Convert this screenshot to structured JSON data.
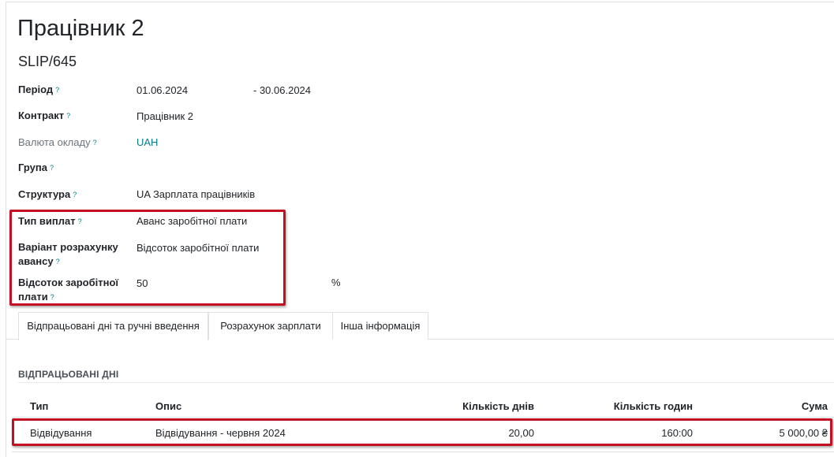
{
  "header": {
    "title": "Працівник 2",
    "reference": "SLIP/645"
  },
  "help_mark": "?",
  "fields": {
    "period": {
      "label": "Період",
      "from": "01.06.2024",
      "to": "- 30.06.2024"
    },
    "contract": {
      "label": "Контракт",
      "value": "Працівник 2"
    },
    "salary_currency": {
      "label": "Валюта окладу",
      "value": "UAH"
    },
    "group": {
      "label": "Група",
      "value": ""
    },
    "structure": {
      "label": "Структура",
      "value": "UA Зарплата працівників"
    },
    "payment_type": {
      "label": "Тип виплат",
      "value": "Аванс заробітної плати"
    },
    "advance_variant": {
      "label_line1": "Варіант розрахунку",
      "label_line2": "авансу",
      "value": "Відсоток заробітної плати"
    },
    "salary_percent": {
      "label_line1": "Відсоток заробітної",
      "label_line2": "плати",
      "value": "50",
      "unit": "%"
    }
  },
  "tabs": [
    {
      "label": "Відпрацьовані дні та ручні введення",
      "active": true
    },
    {
      "label": "Розрахунок зарплати",
      "active": false
    },
    {
      "label": "Інша інформація",
      "active": false
    }
  ],
  "worked_days": {
    "title": "ВІДПРАЦЬОВАНІ ДНІ",
    "columns": [
      "Тип",
      "Опис",
      "Кількість днів",
      "Кількість годин",
      "Сума"
    ],
    "rows": [
      {
        "type": "Відвідування",
        "description": "Відвідування - червня 2024",
        "days": "20,00",
        "hours": "160:00",
        "amount": "5 000,00 ₴"
      }
    ]
  },
  "colors": {
    "accent": "#017e84",
    "highlight": "#c30f1f"
  }
}
